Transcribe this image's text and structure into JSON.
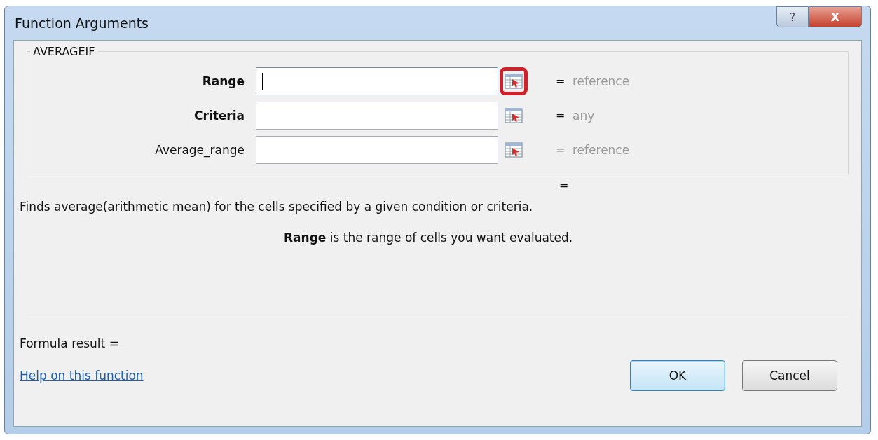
{
  "window": {
    "title": "Function Arguments"
  },
  "title_buttons": [
    {
      "kind": "help",
      "label": "?"
    },
    {
      "kind": "close",
      "label": "X"
    }
  ],
  "function": {
    "name": "AVERAGEIF",
    "arguments": [
      {
        "label": "Range",
        "required": true,
        "focused": true,
        "highlighted": true,
        "equals": "=",
        "value_hint": "reference"
      },
      {
        "label": "Criteria",
        "required": true,
        "focused": false,
        "highlighted": false,
        "equals": "=",
        "value_hint": "any"
      },
      {
        "label": "Average_range",
        "required": false,
        "focused": false,
        "highlighted": false,
        "equals": "=",
        "value_hint": "reference"
      }
    ]
  },
  "result_equals": "=",
  "description": "Finds average(arithmetic mean) for the cells specified by a given condition or criteria.",
  "argument_help": "**Range**   is the range of cells you want evaluated.",
  "formula_result": "Formula result =",
  "help_link": "Help on this function",
  "buttons": [
    {
      "label": "OK",
      "default": true
    },
    {
      "label": "Cancel",
      "default": false
    }
  ]
}
